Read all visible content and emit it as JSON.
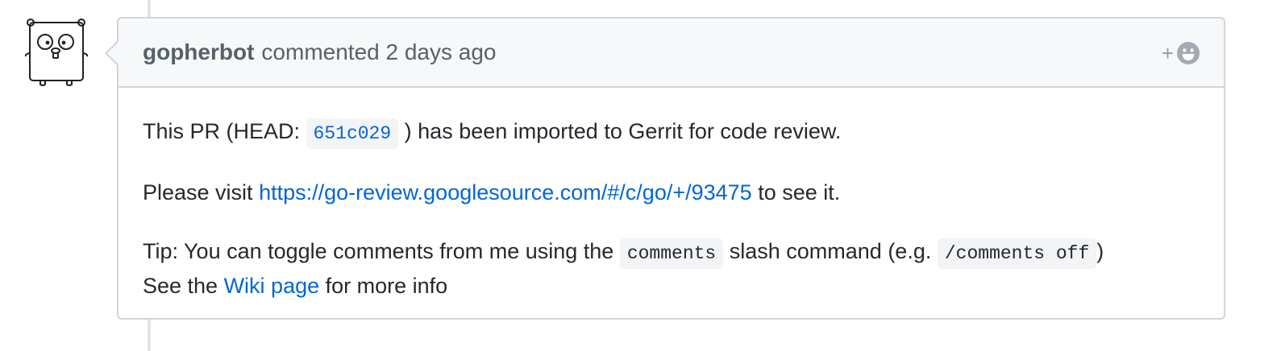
{
  "comment": {
    "author": "gopherbot",
    "action": "commented",
    "time": "2 days ago",
    "reaction": {
      "plus": "+",
      "icon": "smiley-icon"
    }
  },
  "body": {
    "p1_prefix": "This PR (HEAD: ",
    "p1_sha": "651c029",
    "p1_suffix": ") has been imported to Gerrit for code review.",
    "p2_prefix": "Please visit ",
    "p2_link": "https://go-review.googlesource.com/#/c/go/+/93475",
    "p2_suffix": " to see it.",
    "p3_prefix": "Tip: You can toggle comments from me using the ",
    "p3_code1": "comments",
    "p3_middle": " slash command (e.g. ",
    "p3_code2": "/comments off",
    "p3_suffix": ")",
    "p4_prefix": "See the ",
    "p4_link": "Wiki page",
    "p4_suffix": " for more info"
  },
  "colors": {
    "link": "#0366d6",
    "header_bg": "#f6f8fa",
    "border": "#d1d5da",
    "muted_text": "#586069"
  }
}
